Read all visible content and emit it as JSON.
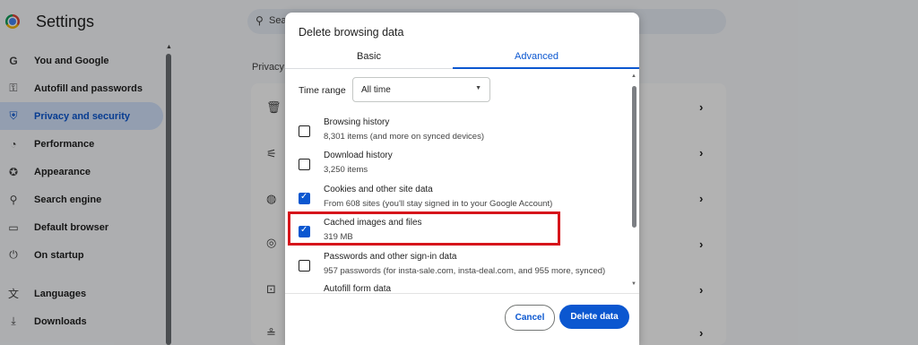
{
  "app": {
    "title": "Settings"
  },
  "search": {
    "placeholder": "Sea"
  },
  "sidebar": {
    "items": [
      {
        "icon": "google-g-icon",
        "glyph": "G",
        "label": "You and Google"
      },
      {
        "icon": "key-icon",
        "glyph": "⚿",
        "label": "Autofill and passwords"
      },
      {
        "icon": "shield-icon",
        "glyph": "⛨",
        "label": "Privacy and security",
        "active": true
      },
      {
        "icon": "speedometer-icon",
        "glyph": "◔",
        "label": "Performance"
      },
      {
        "icon": "palette-icon",
        "glyph": "✪",
        "label": "Appearance"
      },
      {
        "icon": "search-icon",
        "glyph": "⚲",
        "label": "Search engine"
      },
      {
        "icon": "browser-window-icon",
        "glyph": "▭",
        "label": "Default browser"
      },
      {
        "icon": "power-icon",
        "glyph": "⏻",
        "label": "On startup"
      },
      {
        "icon": "translate-icon",
        "glyph": "文",
        "label": "Languages"
      },
      {
        "icon": "download-icon",
        "glyph": "⤓",
        "label": "Downloads"
      }
    ]
  },
  "main": {
    "section_label": "Privacy"
  },
  "dialog": {
    "title": "Delete browsing data",
    "tabs": {
      "basic": "Basic",
      "advanced": "Advanced"
    },
    "time_range": {
      "label": "Time range",
      "value": "All time"
    },
    "options": [
      {
        "title": "Browsing history",
        "subtitle": "8,301 items (and more on synced devices)",
        "checked": false
      },
      {
        "title": "Download history",
        "subtitle": "3,250 items",
        "checked": false
      },
      {
        "title": "Cookies and other site data",
        "subtitle": "From 608 sites (you'll stay signed in to your Google Account)",
        "checked": true
      },
      {
        "title": "Cached images and files",
        "subtitle": "319 MB",
        "checked": true
      },
      {
        "title": "Passwords and other sign-in data",
        "subtitle": "957 passwords (for insta-sale.com, insta-deal.com, and 955 more, synced)",
        "checked": false
      },
      {
        "title": "Autofill form data",
        "subtitle": "",
        "checked": false
      }
    ],
    "buttons": {
      "cancel": "Cancel",
      "delete": "Delete data"
    }
  },
  "colors": {
    "accent": "#0b57d0",
    "highlight": "#d6151b",
    "active_nav_bg": "#d3e3fd"
  }
}
